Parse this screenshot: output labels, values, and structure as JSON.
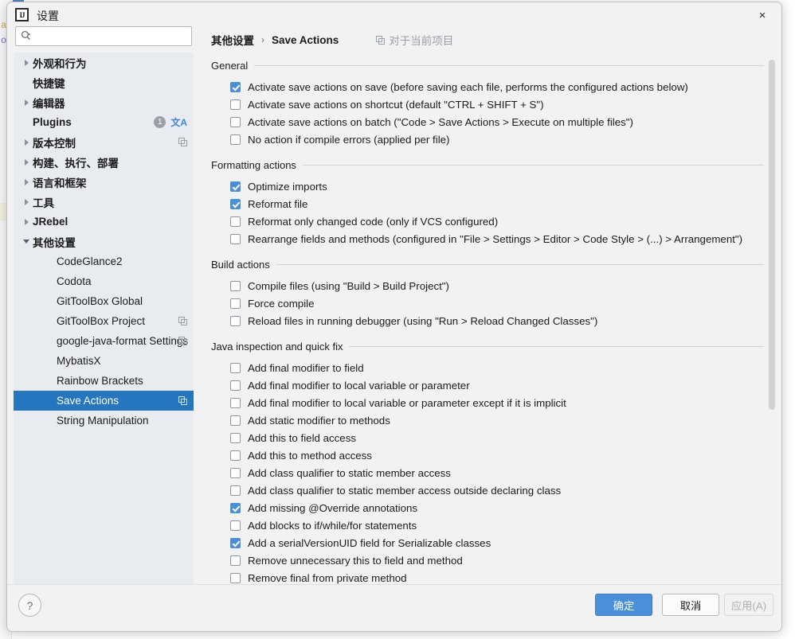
{
  "window": {
    "title": "设置",
    "logo_text": "IJ",
    "close_icon": "×"
  },
  "search": {
    "value": "",
    "placeholder": ""
  },
  "sidebar": {
    "items": [
      {
        "label": "外观和行为",
        "indent": 0,
        "twisty": "right",
        "bold": true,
        "selected": false,
        "badge": null,
        "translate": false,
        "copy": false
      },
      {
        "label": "快捷键",
        "indent": 0,
        "twisty": "none",
        "bold": true,
        "selected": false,
        "badge": null,
        "translate": false,
        "copy": false
      },
      {
        "label": "编辑器",
        "indent": 0,
        "twisty": "right",
        "bold": true,
        "selected": false,
        "badge": null,
        "translate": false,
        "copy": false
      },
      {
        "label": "Plugins",
        "indent": 0,
        "twisty": "none",
        "bold": true,
        "selected": false,
        "badge": "1",
        "translate": true,
        "copy": false
      },
      {
        "label": "版本控制",
        "indent": 0,
        "twisty": "right",
        "bold": true,
        "selected": false,
        "badge": null,
        "translate": false,
        "copy": true
      },
      {
        "label": "构建、执行、部署",
        "indent": 0,
        "twisty": "right",
        "bold": true,
        "selected": false,
        "badge": null,
        "translate": false,
        "copy": false
      },
      {
        "label": "语言和框架",
        "indent": 0,
        "twisty": "right",
        "bold": true,
        "selected": false,
        "badge": null,
        "translate": false,
        "copy": false
      },
      {
        "label": "工具",
        "indent": 0,
        "twisty": "right",
        "bold": true,
        "selected": false,
        "badge": null,
        "translate": false,
        "copy": false
      },
      {
        "label": "JRebel",
        "indent": 0,
        "twisty": "right",
        "bold": true,
        "selected": false,
        "badge": null,
        "translate": false,
        "copy": false
      },
      {
        "label": "其他设置",
        "indent": 0,
        "twisty": "down",
        "bold": true,
        "selected": false,
        "badge": null,
        "translate": false,
        "copy": false
      },
      {
        "label": "CodeGlance2",
        "indent": 1,
        "twisty": "none",
        "bold": false,
        "selected": false,
        "badge": null,
        "translate": false,
        "copy": false
      },
      {
        "label": "Codota",
        "indent": 1,
        "twisty": "none",
        "bold": false,
        "selected": false,
        "badge": null,
        "translate": false,
        "copy": false
      },
      {
        "label": "GitToolBox Global",
        "indent": 1,
        "twisty": "none",
        "bold": false,
        "selected": false,
        "badge": null,
        "translate": false,
        "copy": false
      },
      {
        "label": "GitToolBox Project",
        "indent": 1,
        "twisty": "none",
        "bold": false,
        "selected": false,
        "badge": null,
        "translate": false,
        "copy": true
      },
      {
        "label": "google-java-format Settings",
        "indent": 1,
        "twisty": "none",
        "bold": false,
        "selected": false,
        "badge": null,
        "translate": false,
        "copy": true
      },
      {
        "label": "MybatisX",
        "indent": 1,
        "twisty": "none",
        "bold": false,
        "selected": false,
        "badge": null,
        "translate": false,
        "copy": false
      },
      {
        "label": "Rainbow Brackets",
        "indent": 1,
        "twisty": "none",
        "bold": false,
        "selected": false,
        "badge": null,
        "translate": false,
        "copy": false
      },
      {
        "label": "Save Actions",
        "indent": 1,
        "twisty": "none",
        "bold": false,
        "selected": true,
        "badge": null,
        "translate": false,
        "copy": true
      },
      {
        "label": "String Manipulation",
        "indent": 1,
        "twisty": "none",
        "bold": false,
        "selected": false,
        "badge": null,
        "translate": false,
        "copy": false
      }
    ]
  },
  "breadcrumb": {
    "parent": "其他设置",
    "separator": "›",
    "current": "Save Actions",
    "project_scope": "对于当前项目"
  },
  "groups": [
    {
      "title": "General",
      "options": [
        {
          "label": "Activate save actions on save (before saving each file, performs the configured actions below)",
          "checked": true
        },
        {
          "label": "Activate save actions on shortcut (default \"CTRL + SHIFT + S\")",
          "checked": false
        },
        {
          "label": "Activate save actions on batch (\"Code > Save Actions > Execute on multiple files\")",
          "checked": false
        },
        {
          "label": "No action if compile errors (applied per file)",
          "checked": false
        }
      ]
    },
    {
      "title": "Formatting actions",
      "options": [
        {
          "label": "Optimize imports",
          "checked": true
        },
        {
          "label": "Reformat file",
          "checked": true
        },
        {
          "label": "Reformat only changed code (only if VCS configured)",
          "checked": false
        },
        {
          "label": "Rearrange fields and methods (configured in \"File > Settings > Editor > Code Style > (...) > Arrangement\")",
          "checked": false
        }
      ]
    },
    {
      "title": "Build actions",
      "options": [
        {
          "label": "Compile files (using \"Build > Build Project\")",
          "checked": false
        },
        {
          "label": "Force compile",
          "checked": false
        },
        {
          "label": "Reload files in running debugger (using \"Run > Reload Changed Classes\")",
          "checked": false
        }
      ]
    },
    {
      "title": "Java inspection and quick fix",
      "options": [
        {
          "label": "Add final modifier to field",
          "checked": false
        },
        {
          "label": "Add final modifier to local variable or parameter",
          "checked": false
        },
        {
          "label": "Add final modifier to local variable or parameter except if it is implicit",
          "checked": false
        },
        {
          "label": "Add static modifier to methods",
          "checked": false
        },
        {
          "label": "Add this to field access",
          "checked": false
        },
        {
          "label": "Add this to method access",
          "checked": false
        },
        {
          "label": "Add class qualifier to static member access",
          "checked": false
        },
        {
          "label": "Add class qualifier to static member access outside declaring class",
          "checked": false
        },
        {
          "label": "Add missing @Override annotations",
          "checked": true
        },
        {
          "label": "Add blocks to if/while/for statements",
          "checked": false
        },
        {
          "label": "Add a serialVersionUID field for Serializable classes",
          "checked": true
        },
        {
          "label": "Remove unnecessary this to field and method",
          "checked": false
        },
        {
          "label": "Remove final from private method",
          "checked": false
        }
      ]
    }
  ],
  "footer": {
    "help_label": "?",
    "ok_label": "确定",
    "cancel_label": "取消",
    "apply_label": "应用(A)"
  },
  "backdrop": {
    "line1": "a",
    "line2": "o"
  },
  "colors": {
    "accent": "#4a90d9",
    "selection": "#2675bf",
    "sidebar_bg": "#e8ebf0",
    "dialog_bg": "#f2f2f2"
  }
}
